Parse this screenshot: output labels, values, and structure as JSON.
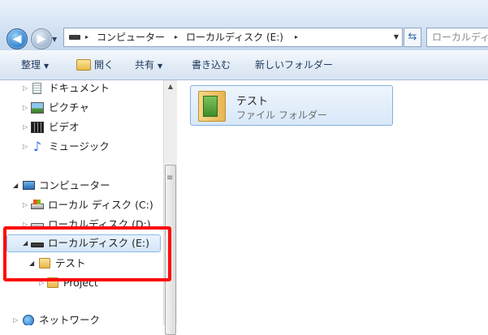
{
  "address_bar": {
    "back_icon": "back-arrow-icon",
    "forward_icon": "forward-arrow-icon",
    "breadcrumbs": [
      "コンピューター",
      "ローカルディスク (E:)"
    ],
    "separator": "▸",
    "search_placeholder": "ローカルディ"
  },
  "command_bar": {
    "organize": "整理",
    "open": "開く",
    "share": "共有",
    "burn": "書き込む",
    "new_folder": "新しいフォルダー"
  },
  "nav_pane": {
    "libraries": [
      {
        "label": "ドキュメント",
        "icon": "document-icon"
      },
      {
        "label": "ピクチャ",
        "icon": "picture-icon"
      },
      {
        "label": "ビデオ",
        "icon": "video-icon"
      },
      {
        "label": "ミュージック",
        "icon": "music-icon"
      }
    ],
    "computer": {
      "label": "コンピューター",
      "icon": "computer-icon"
    },
    "drives": [
      {
        "label": "ローカル ディスク (C:)",
        "icon": "drive-icon"
      },
      {
        "label": "ローカルディスク (D:)",
        "icon": "drive-icon"
      },
      {
        "label": "ローカルディスク (E:)",
        "icon": "drive-icon"
      }
    ],
    "folders": [
      {
        "label": "テスト",
        "icon": "folder-icon"
      },
      {
        "label": "Project",
        "icon": "folder-icon"
      }
    ],
    "network": {
      "label": "ネットワーク",
      "icon": "network-icon"
    }
  },
  "content": {
    "items": [
      {
        "name": "テスト",
        "type": "ファイル フォルダー",
        "icon": "folder-icon"
      }
    ]
  },
  "colors": {
    "highlight": "#ff0a0a",
    "selection_border": "#86b0de"
  }
}
